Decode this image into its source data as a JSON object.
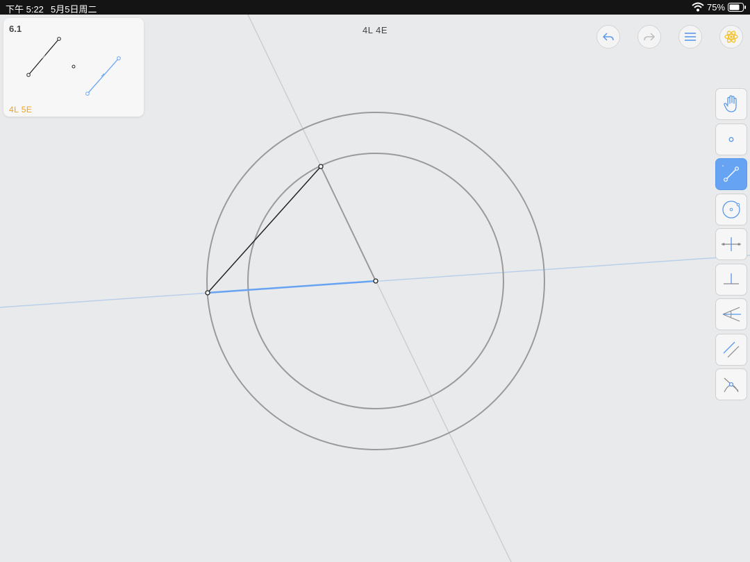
{
  "status_bar": {
    "time": "下午 5:22",
    "date": "5月5日周二",
    "battery": "75%"
  },
  "header": {
    "moves": "4L 4E"
  },
  "goal": {
    "level": "6.1",
    "score": "4L 5E"
  },
  "top_buttons": [
    "undo-icon",
    "redo-icon",
    "menu-icon",
    "hint-icon"
  ],
  "tools": [
    "hand-icon",
    "point-icon",
    "line-icon",
    "circle-icon",
    "perpendicular-bisector-icon",
    "perpendicular-icon",
    "angle-bisector-icon",
    "parallel-icon",
    "intersect-icon"
  ],
  "colors": {
    "accent_blue": "#66a3f2",
    "construction_gray": "#9a9a9a",
    "score_orange": "#f2a21d",
    "hint_yellow": "#f4c430"
  }
}
